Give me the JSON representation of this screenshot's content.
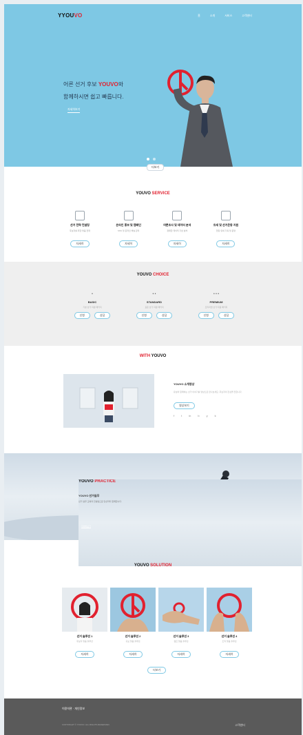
{
  "brand": {
    "logo_prefix": "Y",
    "logo_main": "YOU",
    "logo_red": "VO"
  },
  "nav": [
    "홈",
    "소개",
    "서비스",
    "고객센터"
  ],
  "hero": {
    "line1_prefix": "어른 선거 후보 ",
    "line1_brand": "YOUVO",
    "line1_suffix": "와",
    "line2": "함께하시면 쉽고 빠릅니다.",
    "cta": "자세히보기",
    "scroll_btn": "더보기"
  },
  "service": {
    "title_black": "YOUVO ",
    "title_red": "SERVICE",
    "items": [
      {
        "title": "선거 전략 컨설팅",
        "desc": "후보자를 위한 맞춤 전략",
        "btn": "자세히"
      },
      {
        "title": "온라인 홍보 및 캠페인",
        "desc": "SNS 및 온라인 채널 관리",
        "btn": "자세히"
      },
      {
        "title": "여론조사 및 데이터 분석",
        "desc": "정확한 데이터 기반 분석",
        "btn": "자세히"
      },
      {
        "title": "유세 및 선거운동 지원",
        "desc": "현장 유세 기획 및 운영",
        "btn": "자세히"
      }
    ]
  },
  "choice": {
    "title_black": "YOUVO ",
    "title_red": "CHOICE",
    "items": [
      {
        "icon": "•",
        "title": "BASIC",
        "desc": "기본 선거 지원 패키지",
        "btn1": "신청",
        "btn2": "상담"
      },
      {
        "icon": "• •",
        "title": "STANDARD",
        "desc": "표준 선거 지원 패키지",
        "btn1": "신청",
        "btn2": "상담"
      },
      {
        "icon": "• • •",
        "title": "PREMIUM",
        "desc": "프리미엄 선거 지원 패키지",
        "btn1": "신청",
        "btn2": "상담"
      }
    ]
  },
  "with": {
    "title_red": "WITH",
    "title_black": " YOUVO",
    "side_title": "YOUVO 소개영상",
    "side_desc": "유보와 함께하는 선거 이야기를 영상으로 만나보세요. 후보자의 진심을 전합니다.",
    "side_btn": "영상보기",
    "social": [
      "f",
      "t",
      "in",
      "b",
      "y",
      "k"
    ]
  },
  "practice": {
    "title_black": "YOUVO ",
    "title_red": "PRACTICE",
    "subtitle": "YOUVO 선거실무",
    "desc": "선거 실무 교육과 컨설팅으로 당선까지 함께합니다.",
    "link": "자세히보기"
  },
  "solution": {
    "title_black": "YOUVO ",
    "title_red": "SOLUTION",
    "items": [
      {
        "title": "선거 솔루션 1",
        "desc": "후보자 맞춤 솔루션",
        "btn": "자세히"
      },
      {
        "title": "선거 솔루션 2",
        "desc": "홍보 맞춤 솔루션",
        "btn": "자세히"
      },
      {
        "title": "선거 솔루션 3",
        "desc": "캠프 맞춤 솔루션",
        "btn": "자세히"
      },
      {
        "title": "선거 솔루션 4",
        "desc": "조직 맞춤 솔루션",
        "btn": "자세히"
      }
    ],
    "more_btn": "더보기"
  },
  "footer": {
    "links": "이용약관 · 개인정보",
    "copy": "COPYRIGHT © YOUVO. ALL RIGHTS RESERVED.",
    "right": "고객센터"
  },
  "colors": {
    "accent_red": "#e1212f",
    "hero_blue": "#7ec8e4",
    "footer_gray": "#5a5a5a"
  }
}
